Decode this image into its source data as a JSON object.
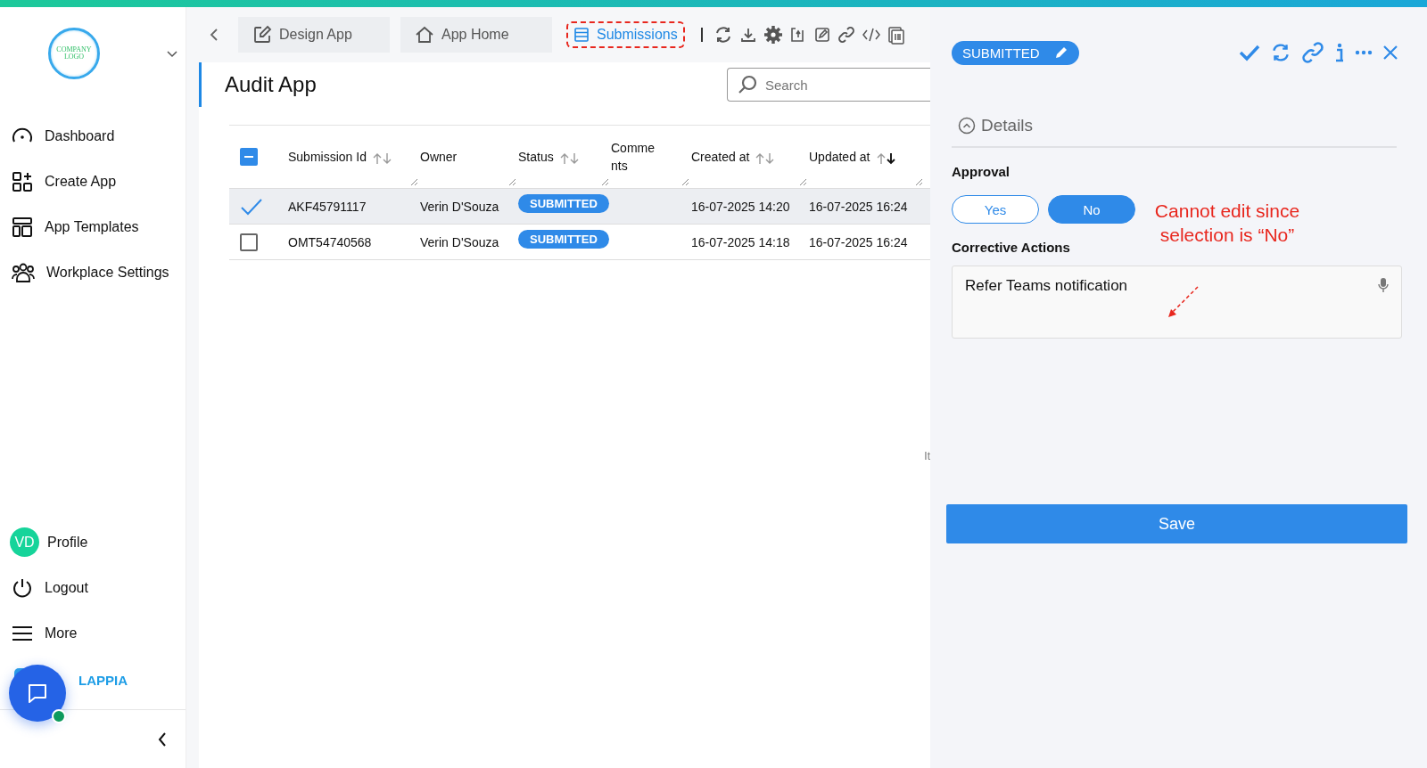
{
  "sidebar": {
    "logo_lines": [
      "COMPANY",
      "LOGO"
    ],
    "nav": [
      {
        "label": "Dashboard"
      },
      {
        "label": "Create App"
      },
      {
        "label": "App Templates"
      },
      {
        "label": "Workplace Settings"
      }
    ],
    "profile": {
      "initials": "VD",
      "label": "Profile"
    },
    "bottom_nav": [
      {
        "label": "Logout"
      },
      {
        "label": "More"
      }
    ],
    "brand": "LAPPIA"
  },
  "tabs": [
    {
      "label": "Design App",
      "selected": false,
      "highlighted": false
    },
    {
      "label": "App Home",
      "selected": false,
      "highlighted": false
    },
    {
      "label": "Submissions",
      "selected": true,
      "highlighted": true
    }
  ],
  "page_title": "Audit App",
  "search": {
    "placeholder": "Search"
  },
  "table": {
    "select_all_partial": true,
    "columns": [
      {
        "label": "Submission Id",
        "sorted_desc": false
      },
      {
        "label": "Owner"
      },
      {
        "label": "Status",
        "sorted_desc": false
      },
      {
        "label": "Comments"
      },
      {
        "label": "Created at",
        "sorted_desc": false
      },
      {
        "label": "Updated at",
        "sorted_desc": true
      }
    ],
    "rows": [
      {
        "selected": true,
        "id": "AKF45791117",
        "owner": "Verin D'Souza",
        "status": "SUBMITTED",
        "created": "16-07-2025 14:20",
        "updated": "16-07-2025 16:24"
      },
      {
        "selected": false,
        "id": "OMT54740568",
        "owner": "Verin D'Souza",
        "status": "SUBMITTED",
        "created": "16-07-2025 14:18",
        "updated": "16-07-2025 16:24"
      }
    ]
  },
  "stray_text": "It",
  "drawer": {
    "status": "SUBMITTED",
    "section": {
      "title": "Details",
      "expanded": true
    },
    "fields": [
      {
        "kind": "choice",
        "label": "Approval",
        "options": [
          {
            "label": "Yes",
            "selected": false
          },
          {
            "label": "No",
            "selected": true
          }
        ]
      },
      {
        "kind": "textarea",
        "label": "Corrective Actions",
        "value": "Refer Teams notification"
      }
    ],
    "save": "Save"
  },
  "annotation": {
    "text": "Cannot edit since selection is “No”"
  }
}
